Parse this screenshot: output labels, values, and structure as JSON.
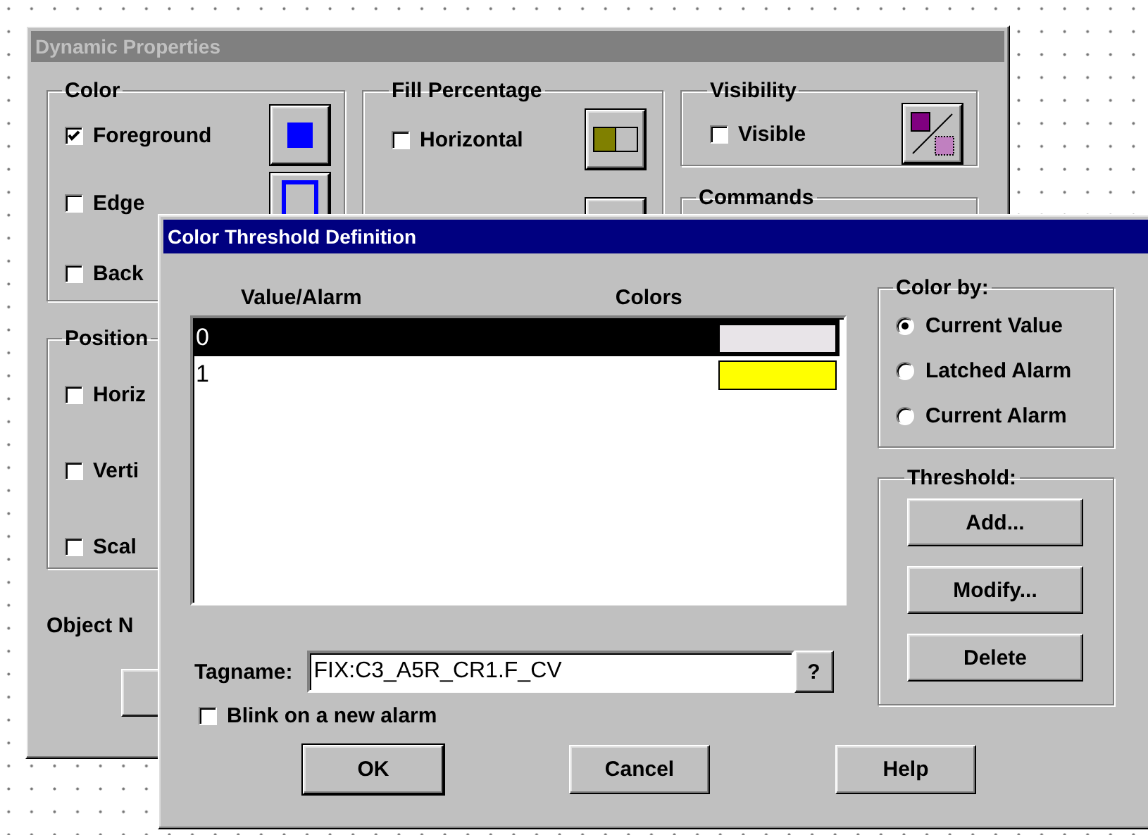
{
  "back_window": {
    "title": "Dynamic Properties",
    "active": false,
    "color_group": {
      "label": "Color",
      "items": [
        {
          "label": "Foreground",
          "checked": true
        },
        {
          "label": "Edge",
          "checked": false
        },
        {
          "label": "Back",
          "checked": false
        }
      ]
    },
    "fill_group": {
      "label": "Fill Percentage",
      "items": [
        {
          "label": "Horizontal",
          "checked": false
        }
      ]
    },
    "visibility_group": {
      "label": "Visibility",
      "items": [
        {
          "label": "Visible",
          "checked": false
        }
      ]
    },
    "commands_group": {
      "label": "Commands"
    },
    "position_group": {
      "label": "Position",
      "items": [
        {
          "label": "Horiz",
          "checked": false
        },
        {
          "label": "Verti",
          "checked": false
        },
        {
          "label": "Scal",
          "checked": false
        }
      ]
    },
    "object_name_label": "Object N"
  },
  "dialog": {
    "title": "Color Threshold Definition",
    "active": true,
    "columns": [
      "Value/Alarm",
      "Colors"
    ],
    "rows": [
      {
        "value": "0",
        "color": "#e8e4e8",
        "selected": true
      },
      {
        "value": "1",
        "color": "#ffff00",
        "selected": false
      }
    ],
    "color_by": {
      "label": "Color by:",
      "options": [
        {
          "label": "Current Value",
          "selected": true
        },
        {
          "label": "Latched Alarm",
          "selected": false
        },
        {
          "label": "Current Alarm",
          "selected": false
        }
      ]
    },
    "threshold": {
      "label": "Threshold:",
      "buttons": [
        "Add...",
        "Modify...",
        "Delete"
      ]
    },
    "tagname": {
      "label": "Tagname:",
      "value": "FIX:C3_A5R_CR1.F_CV",
      "browse_button": "?"
    },
    "blink": {
      "label": "Blink on a new alarm",
      "checked": false
    },
    "buttons": [
      "OK",
      "Cancel",
      "Help"
    ]
  }
}
